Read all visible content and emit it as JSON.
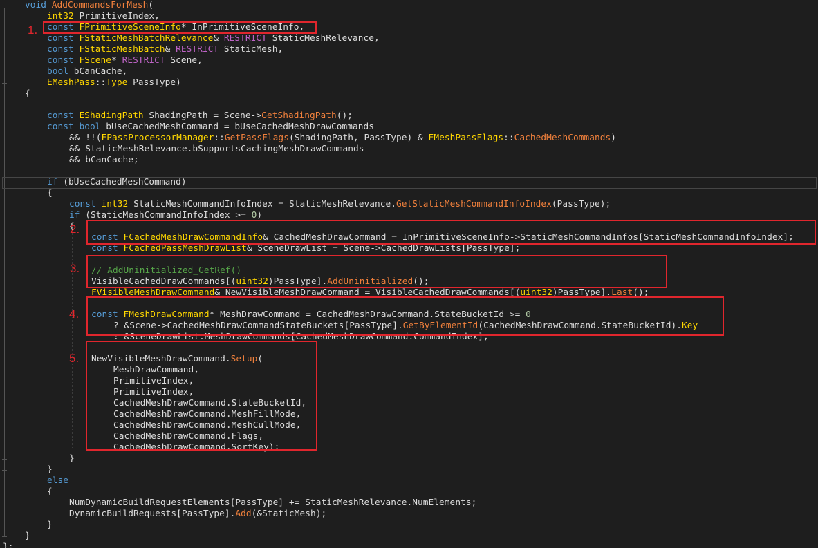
{
  "code_lines": [
    [
      [
        "kw",
        "void "
      ],
      [
        "fn",
        "AddCommandsForMesh"
      ],
      [
        "plain",
        "("
      ]
    ],
    [
      [
        "type",
        "int32"
      ],
      [
        "plain",
        " PrimitiveIndex,"
      ]
    ],
    [
      [
        "kw",
        "const "
      ],
      [
        "type",
        "FPrimitiveSceneInfo"
      ],
      [
        "plain",
        "* InPrimitiveSceneInfo,"
      ]
    ],
    [
      [
        "kw",
        "const "
      ],
      [
        "type",
        "FStaticMeshBatchRelevance"
      ],
      [
        "plain",
        "& "
      ],
      [
        "macro",
        "RESTRICT"
      ],
      [
        "plain",
        " StaticMeshRelevance,"
      ]
    ],
    [
      [
        "kw",
        "const "
      ],
      [
        "type",
        "FStaticMeshBatch"
      ],
      [
        "plain",
        "& "
      ],
      [
        "macro",
        "RESTRICT"
      ],
      [
        "plain",
        " StaticMesh,"
      ]
    ],
    [
      [
        "kw",
        "const "
      ],
      [
        "type",
        "FScene"
      ],
      [
        "plain",
        "* "
      ],
      [
        "macro",
        "RESTRICT"
      ],
      [
        "plain",
        " Scene,"
      ]
    ],
    [
      [
        "kw",
        "bool"
      ],
      [
        "plain",
        " bCanCache,"
      ]
    ],
    [
      [
        "type",
        "EMeshPass"
      ],
      [
        "plain",
        "::"
      ],
      [
        "type",
        "Type"
      ],
      [
        "plain",
        " PassType)"
      ]
    ],
    [
      [
        "plain",
        "{"
      ]
    ],
    [],
    [
      [
        "kw",
        "const "
      ],
      [
        "type",
        "EShadingPath"
      ],
      [
        "plain",
        " ShadingPath = Scene->"
      ],
      [
        "fn",
        "GetShadingPath"
      ],
      [
        "plain",
        "();"
      ]
    ],
    [
      [
        "kw",
        "const bool"
      ],
      [
        "plain",
        " bUseCachedMeshCommand = bUseCachedMeshDrawCommands"
      ]
    ],
    [
      [
        "plain",
        "&& !!("
      ],
      [
        "type",
        "FPassProcessorManager"
      ],
      [
        "plain",
        "::"
      ],
      [
        "fn",
        "GetPassFlags"
      ],
      [
        "plain",
        "(ShadingPath, PassType) & "
      ],
      [
        "type",
        "EMeshPassFlags"
      ],
      [
        "plain",
        "::"
      ],
      [
        "fn",
        "CachedMeshCommands"
      ],
      [
        "plain",
        ")"
      ]
    ],
    [
      [
        "plain",
        "&& StaticMeshRelevance.bSupportsCachingMeshDrawCommands"
      ]
    ],
    [
      [
        "plain",
        "&& bCanCache;"
      ]
    ],
    [],
    [
      [
        "kw",
        "if"
      ],
      [
        "plain",
        " (bUseCachedMeshCommand)"
      ]
    ],
    [
      [
        "plain",
        "{"
      ]
    ],
    [
      [
        "kw",
        "const "
      ],
      [
        "type",
        "int32"
      ],
      [
        "plain",
        " StaticMeshCommandInfoIndex = StaticMeshRelevance."
      ],
      [
        "fn",
        "GetStaticMeshCommandInfoIndex"
      ],
      [
        "plain",
        "(PassType);"
      ]
    ],
    [
      [
        "kw",
        "if"
      ],
      [
        "plain",
        " (StaticMeshCommandInfoIndex >= "
      ],
      [
        "num",
        "0"
      ],
      [
        "plain",
        ")"
      ]
    ],
    [
      [
        "plain",
        "{"
      ]
    ],
    [
      [
        "kw",
        "const "
      ],
      [
        "type",
        "FCachedMeshDrawCommandInfo"
      ],
      [
        "plain",
        "& CachedMeshDrawCommand = InPrimitiveSceneInfo->StaticMeshCommandInfos[StaticMeshCommandInfoIndex];"
      ]
    ],
    [
      [
        "kw",
        "const "
      ],
      [
        "type",
        "FCachedPassMeshDrawList"
      ],
      [
        "plain",
        "& SceneDrawList = Scene->CachedDrawLists[PassType];"
      ]
    ],
    [],
    [
      [
        "comment",
        "// AddUninitialized_GetRef()"
      ]
    ],
    [
      [
        "plain",
        "VisibleCachedDrawCommands[("
      ],
      [
        "type",
        "uint32"
      ],
      [
        "plain",
        ")PassType]."
      ],
      [
        "fn",
        "AddUninitialized"
      ],
      [
        "plain",
        "();"
      ]
    ],
    [
      [
        "type",
        "FVisibleMeshDrawCommand"
      ],
      [
        "plain",
        "& NewVisibleMeshDrawCommand = VisibleCachedDrawCommands[("
      ],
      [
        "type",
        "uint32"
      ],
      [
        "plain",
        ")PassType]."
      ],
      [
        "fn",
        "Last"
      ],
      [
        "plain",
        "();"
      ]
    ],
    [],
    [
      [
        "kw",
        "const "
      ],
      [
        "type",
        "FMeshDrawCommand"
      ],
      [
        "plain",
        "* MeshDrawCommand = CachedMeshDrawCommand.StateBucketId >= "
      ],
      [
        "num",
        "0"
      ]
    ],
    [
      [
        "plain",
        "? &Scene->CachedMeshDrawCommandStateBuckets[PassType]."
      ],
      [
        "fn",
        "GetByElementId"
      ],
      [
        "plain",
        "(CachedMeshDrawCommand.StateBucketId)."
      ],
      [
        "type",
        "Key"
      ]
    ],
    [
      [
        "plain",
        ": &SceneDrawList.MeshDrawCommands[CachedMeshDrawCommand.CommandIndex];"
      ]
    ],
    [],
    [
      [
        "plain",
        "NewVisibleMeshDrawCommand."
      ],
      [
        "fn",
        "Setup"
      ],
      [
        "plain",
        "("
      ]
    ],
    [
      [
        "plain",
        "MeshDrawCommand,"
      ]
    ],
    [
      [
        "plain",
        "PrimitiveIndex,"
      ]
    ],
    [
      [
        "plain",
        "PrimitiveIndex,"
      ]
    ],
    [
      [
        "plain",
        "CachedMeshDrawCommand.StateBucketId,"
      ]
    ],
    [
      [
        "plain",
        "CachedMeshDrawCommand.MeshFillMode,"
      ]
    ],
    [
      [
        "plain",
        "CachedMeshDrawCommand.MeshCullMode,"
      ]
    ],
    [
      [
        "plain",
        "CachedMeshDrawCommand.Flags,"
      ]
    ],
    [
      [
        "plain",
        "CachedMeshDrawCommand.SortKey);"
      ]
    ],
    [
      [
        "plain",
        "}"
      ]
    ],
    [
      [
        "plain",
        "}"
      ]
    ],
    [
      [
        "kw",
        "else"
      ]
    ],
    [
      [
        "plain",
        "{"
      ]
    ],
    [
      [
        "plain",
        "NumDynamicBuildRequestElements[PassType] += StaticMeshRelevance.NumElements;"
      ]
    ],
    [
      [
        "plain",
        "DynamicBuildRequests[PassType]."
      ],
      [
        "fn",
        "Add"
      ],
      [
        "plain",
        "(&StaticMesh);"
      ]
    ],
    [
      [
        "plain",
        "}"
      ]
    ],
    [
      [
        "plain",
        "}"
      ]
    ],
    [
      [
        "plain",
        "};"
      ]
    ]
  ],
  "annotations": [
    "1.",
    "2.",
    "3.",
    "4.",
    "5."
  ],
  "colors": {
    "background": "#1e1e1e",
    "keyword": "#569cd6",
    "type": "#ffd700",
    "function": "#f0803c",
    "macro": "#bd63c5",
    "comment": "#57a64a",
    "number": "#b5cea8",
    "text": "#dcdcdc",
    "highlight_box": "#e0262d"
  }
}
